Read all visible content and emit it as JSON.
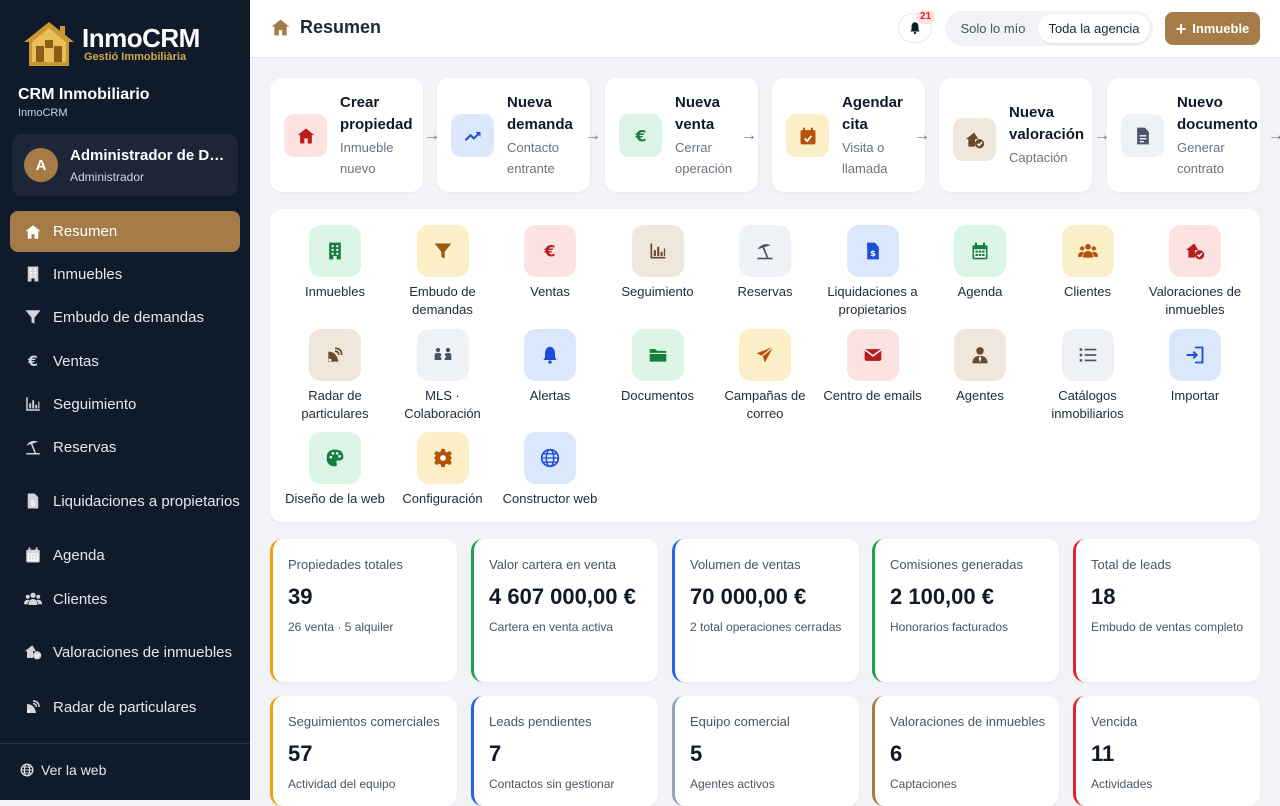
{
  "sidebar": {
    "logo": {
      "name": "InmoCRM",
      "tagline": "Gestió Immobiliària"
    },
    "crm_title": "CRM Inmobiliario",
    "crm_subtitle": "InmoCRM",
    "user": {
      "initial": "A",
      "name": "Administrador de De...",
      "role": "Administrador"
    },
    "nav": [
      {
        "label": "Resumen",
        "icon": "house-icon",
        "active": true
      },
      {
        "label": "Inmuebles",
        "icon": "building-icon"
      },
      {
        "label": "Embudo de demandas",
        "icon": "funnel-icon"
      },
      {
        "label": "Ventas",
        "icon": "euro-icon"
      },
      {
        "label": "Seguimiento",
        "icon": "bar-chart-icon"
      },
      {
        "label": "Reservas",
        "icon": "umbrella-beach-icon"
      },
      {
        "label": "Liquidaciones a propietarios",
        "icon": "invoice-icon"
      },
      {
        "label": "Agenda",
        "icon": "calendar-icon"
      },
      {
        "label": "Clientes",
        "icon": "users-icon"
      },
      {
        "label": "Valoraciones de inmuebles",
        "icon": "house-check-icon"
      },
      {
        "label": "Radar de particulares",
        "icon": "satellite-dish-icon"
      }
    ],
    "footer_link": "Ver la web"
  },
  "header": {
    "title": "Resumen",
    "notifications": "21",
    "scope_options": [
      "Solo lo mío",
      "Toda la agencia"
    ],
    "new_button": "Inmueble"
  },
  "quick_actions": [
    {
      "title": "Crear propiedad",
      "sub": "Inmueble nuevo",
      "icon": "house-icon"
    },
    {
      "title": "Nueva demanda",
      "sub": "Contacto entrante",
      "icon": "trend-up-icon"
    },
    {
      "title": "Nueva venta",
      "sub": "Cerrar operación",
      "icon": "euro-icon"
    },
    {
      "title": "Agendar cita",
      "sub": "Visita o llamada",
      "icon": "calendar-check-icon"
    },
    {
      "title": "Nueva valoración",
      "sub": "Captación",
      "icon": "house-check-icon"
    },
    {
      "title": "Nuevo documento",
      "sub": "Generar contrato",
      "icon": "document-icon"
    }
  ],
  "modules": [
    {
      "label": "Inmuebles",
      "icon": "building-icon"
    },
    {
      "label": "Embudo de demandas",
      "icon": "funnel-icon"
    },
    {
      "label": "Ventas",
      "icon": "euro-icon"
    },
    {
      "label": "Seguimiento",
      "icon": "bar-chart-icon"
    },
    {
      "label": "Reservas",
      "icon": "umbrella-beach-icon"
    },
    {
      "label": "Liquidaciones a propietarios",
      "icon": "invoice-icon"
    },
    {
      "label": "Agenda",
      "icon": "calendar-icon"
    },
    {
      "label": "Clientes",
      "icon": "users-icon"
    },
    {
      "label": "Valoraciones de inmuebles",
      "icon": "house-check-icon"
    },
    {
      "label": "Radar de particulares",
      "icon": "satellite-dish-icon"
    },
    {
      "label": "MLS · Colaboración",
      "icon": "people-exchange-icon"
    },
    {
      "label": "Alertas",
      "icon": "bell-icon"
    },
    {
      "label": "Documentos",
      "icon": "folder-icon"
    },
    {
      "label": "Campañas de correo",
      "icon": "paper-plane-icon"
    },
    {
      "label": "Centro de emails",
      "icon": "envelope-icon"
    },
    {
      "label": "Agentes",
      "icon": "agent-icon"
    },
    {
      "label": "Catálogos inmobiliarios",
      "icon": "list-icon"
    },
    {
      "label": "Importar",
      "icon": "import-icon"
    },
    {
      "label": "Diseño de la web",
      "icon": "palette-icon"
    },
    {
      "label": "Configuración",
      "icon": "gear-icon"
    },
    {
      "label": "Constructor web",
      "icon": "globe-icon"
    }
  ],
  "kpis": [
    {
      "label": "Propiedades totales",
      "value": "39",
      "sub": "26 venta · 5 alquiler"
    },
    {
      "label": "Valor cartera en venta",
      "value": "4 607 000,00 €",
      "sub": "Cartera en venta activa"
    },
    {
      "label": "Volumen de ventas",
      "value": "70 000,00 €",
      "sub": "2 total operaciones cerradas"
    },
    {
      "label": "Comisiones generadas",
      "value": "2 100,00 €",
      "sub": "Honorarios facturados"
    },
    {
      "label": "Total de leads",
      "value": "18",
      "sub": "Embudo de ventas completo"
    },
    {
      "label": "Seguimientos comerciales",
      "value": "57",
      "sub": "Actividad del equipo"
    },
    {
      "label": "Leads pendientes",
      "value": "7",
      "sub": "Contactos sin gestionar"
    },
    {
      "label": "Equipo comercial",
      "value": "5",
      "sub": "Agentes activos"
    },
    {
      "label": "Valoraciones de inmuebles",
      "value": "6",
      "sub": "Captaciones"
    },
    {
      "label": "Vencida",
      "value": "11",
      "sub": "Actividades"
    }
  ],
  "colors": {
    "brand": "#a57b47",
    "sidebar": "#0f1a2b"
  }
}
